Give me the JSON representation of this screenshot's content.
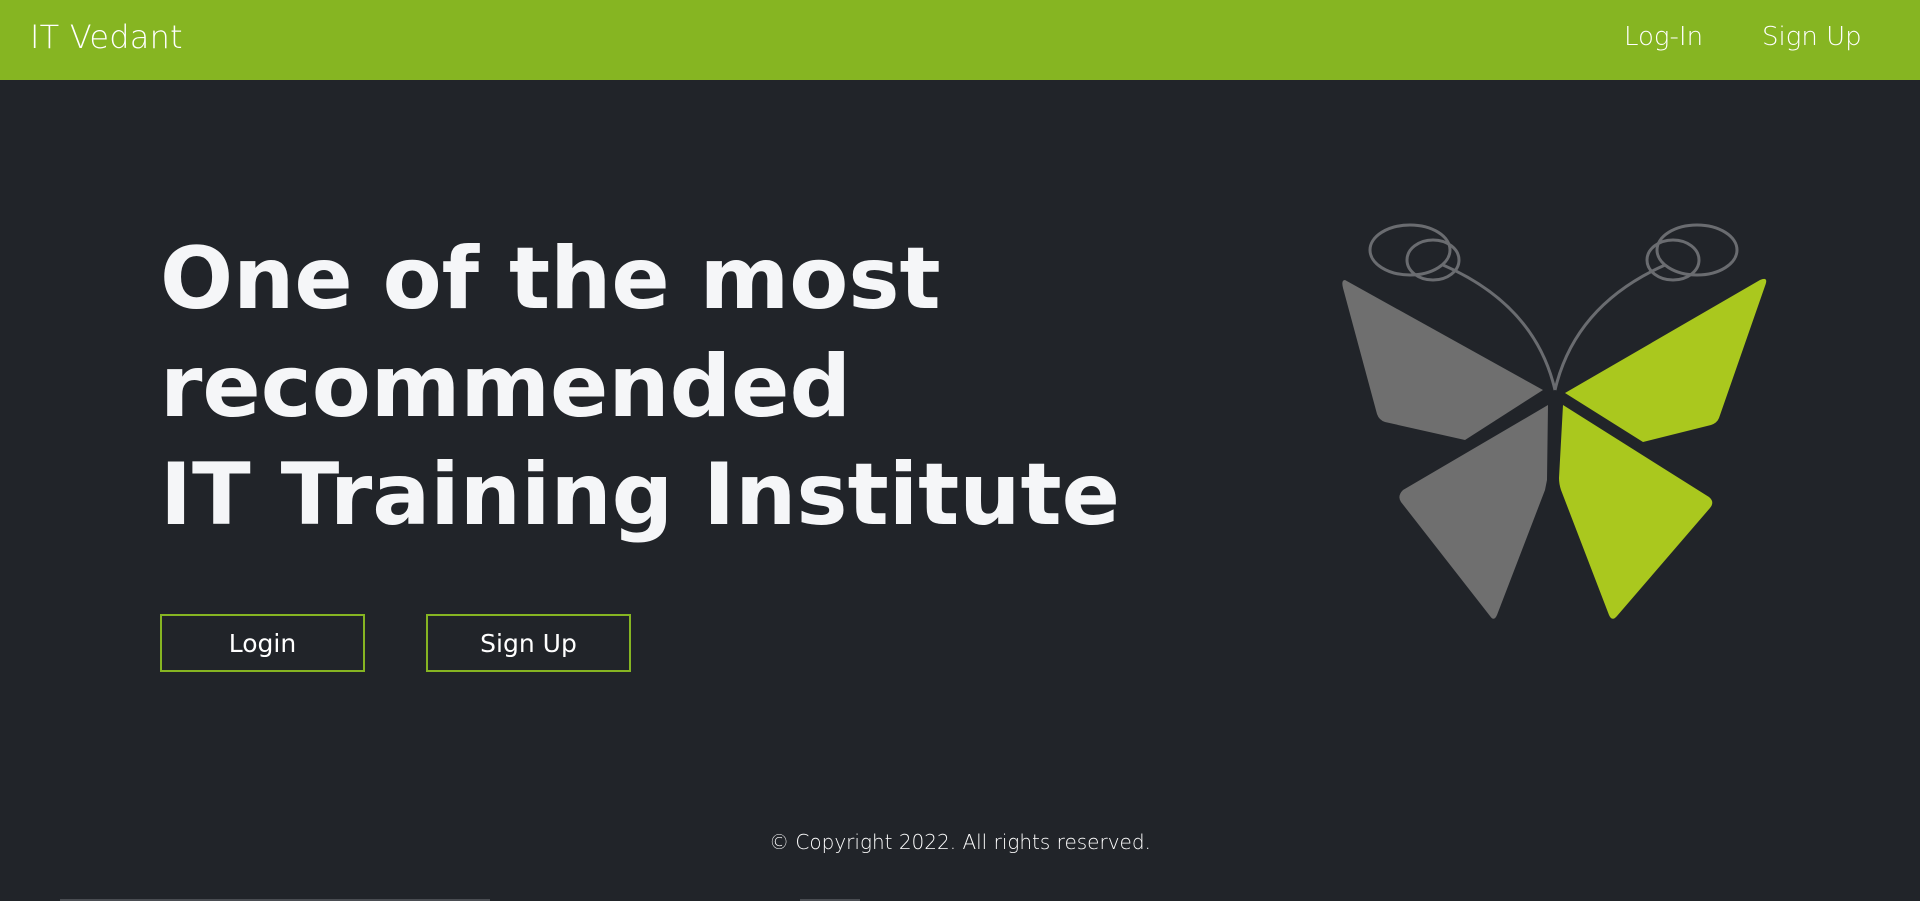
{
  "navbar": {
    "brand": "IT Vedant",
    "links": [
      {
        "label": "Log-In"
      },
      {
        "label": "Sign Up"
      }
    ]
  },
  "hero": {
    "title_lines": [
      "One of the most",
      "recommended",
      "IT Training Institute"
    ],
    "buttons": {
      "login_label": "Login",
      "signup_label": "Sign Up"
    }
  },
  "logo": {
    "icon": "butterfly-logo-icon",
    "colors": {
      "gray": "#6f6f6f",
      "green": "#aac81e",
      "outline": "#6a6c70"
    }
  },
  "footer": {
    "copyright": "© Copyright 2022. All rights reserved."
  },
  "colors": {
    "accent": "#86b522",
    "background": "#212429",
    "text": "#ffffff"
  }
}
